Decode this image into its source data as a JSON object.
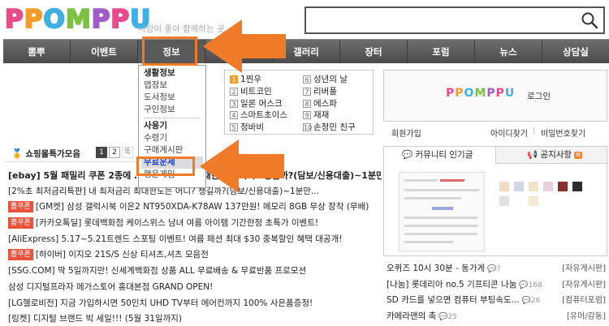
{
  "header": {
    "logo_letters": [
      "P",
      "P",
      "O",
      "M",
      "P",
      "P",
      "U"
    ],
    "logo_colors": [
      "#e64b8c",
      "#f39c2b",
      "#3fb0e3",
      "#7dc142",
      "#a05bc9",
      "#e64b8c",
      "#3fb0e3"
    ],
    "tagline": "사람이 좋아 함께하는 곳",
    "search_placeholder": ""
  },
  "nav": {
    "items": [
      "뽐뿌",
      "이벤트",
      "정보",
      "",
      "갤러리",
      "장터",
      "포럼",
      "뉴스",
      "상담실"
    ]
  },
  "dropdown": {
    "items": [
      {
        "label": "생활정보",
        "kind": "head"
      },
      {
        "label": "앱정보",
        "kind": "item"
      },
      {
        "label": "도서정보",
        "kind": "item"
      },
      {
        "label": "구인정보",
        "kind": "item"
      },
      {
        "label": "사용기",
        "kind": "head"
      },
      {
        "label": "수령기",
        "kind": "item"
      },
      {
        "label": "구매게시판",
        "kind": "item"
      },
      {
        "label": "무료운세",
        "kind": "sel"
      },
      {
        "label": "행운게임",
        "kind": "item"
      }
    ]
  },
  "ranking": {
    "left": [
      {
        "n": "1",
        "label": "1찐우"
      },
      {
        "n": "2",
        "label": "비트코인"
      },
      {
        "n": "3",
        "label": "일론 머스크"
      },
      {
        "n": "4",
        "label": "스마트초이스"
      },
      {
        "n": "5",
        "label": "정바비"
      }
    ],
    "right": [
      {
        "n": "6",
        "label": "성년의 날"
      },
      {
        "n": "7",
        "label": "리버풀"
      },
      {
        "n": "8",
        "label": "에스파"
      },
      {
        "n": "9",
        "label": "재재"
      },
      {
        "n": "10",
        "label": "손정민 친구"
      }
    ]
  },
  "login": {
    "mini_logo": "PPOMPPU",
    "login_label": "로그인",
    "signup": "회원가입",
    "find_id": "아이디찾기",
    "find_pw": "비밀번호찾기",
    "sep": "|"
  },
  "tabs": {
    "community": "커뮤니티 인기글",
    "notice": "공지사항",
    "notice_badge": "N"
  },
  "side_list": [
    {
      "title": "오퀴즈 10시 30분 - 동가게",
      "count": "7",
      "cat": "[자유게시판]"
    },
    {
      "title": "[나눔] 롯데리아 no.5 기프티콘 나눔",
      "count": "168",
      "cat": "[자유게시판]"
    },
    {
      "title": "SD 카드를 넣으면 컴퓨터 부팅속도...",
      "count": "26",
      "cat": "[컴퓨터포럼]"
    },
    {
      "title": "카메라맨의 촉",
      "count": "25",
      "cat": "[유머/감동]"
    }
  ],
  "shopping": {
    "title": "쇼핑몰특가모음",
    "pages": [
      "1",
      "2"
    ],
    "more": "톡",
    "rows": [
      {
        "tag": "",
        "text": "[ebay] 5월 패밀리 쿠폰 2종에 ... 내 최저금리 최대한도는 어디? 챙길까?(담보/신용대출)~1분만..",
        "big": true
      },
      {
        "tag": "",
        "text": "[2%초 최저금리특판] 내 최저금리 최대한도는 어디? 챙길까?(담보/신용대출)~1분만...",
        "big": false
      },
      {
        "tag": "뽐쿠폰",
        "text": "[GM켓] 삼성 갤럭시북 이온2 NT950XDA-K78AW 137만원! 메모리 8GB 무상 장착 (무배)",
        "big": false
      },
      {
        "tag": "뽐쿠폰",
        "text": "[카카오톡딜] 롯데백화점 케이스위스 남녀 여름 아이템 기간한정 초특가 이벤트!",
        "big": false
      },
      {
        "tag": "",
        "text": "[AliExpress] 5.17~5.21트렌드 스포팅 이벤트! 여름 패션 최대 $30 중복할인 혜택 대공개!",
        "big": false
      },
      {
        "tag": "뽐쿠폰",
        "text": "[하이버] 이지오 21S/S 신상 티셔츠,셔츠 모음전",
        "big": false
      },
      {
        "tag": "",
        "text": "[SSG.COM] 딱 5일까지만! 신세계백화점 상품 ALL 무료배송 & 무료반품 프로모션",
        "big": false
      },
      {
        "tag": "",
        "text": "삼성 디지털프라자 메가스토어 홍대본점 GRAND OPEN!",
        "big": false
      },
      {
        "tag": "",
        "text": "[LG헬로비전] 지금 가입하시면 50인치 UHD TV부터 에어컨까지 100% 사은품증정!",
        "big": false
      },
      {
        "tag": "",
        "text": "[링켓] 디지털 브랜드 빅 세일!!! (5월 31일까지)",
        "big": false
      }
    ]
  },
  "colors": {
    "accent_orange": "#ef7b28",
    "nav_bg": "#555555",
    "hot_tag": "#e8533e"
  }
}
